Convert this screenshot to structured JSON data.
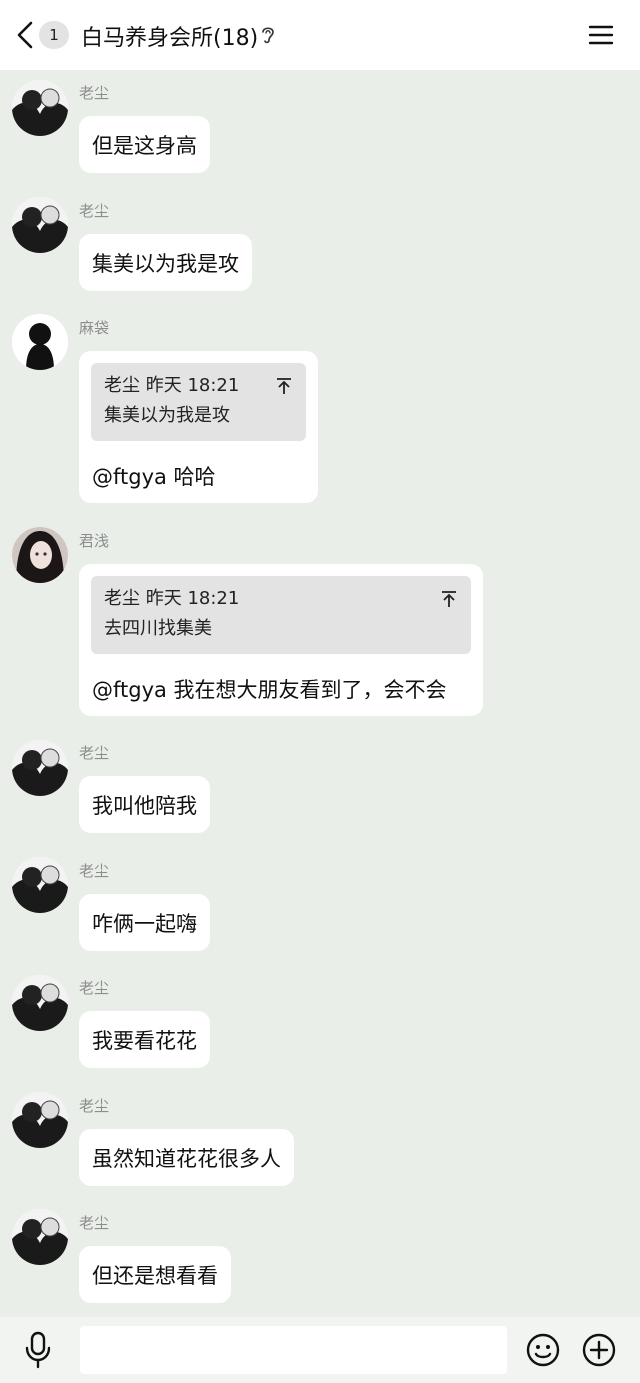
{
  "header": {
    "unread_count": "1",
    "title": "白马养身会所(18)"
  },
  "messages": [
    {
      "sender": "老尘",
      "text": "但是这身高"
    },
    {
      "sender": "老尘",
      "text": "集美以为我是攻"
    },
    {
      "sender": "麻袋",
      "quote": {
        "meta": "老尘 昨天 18:21",
        "text": "集美以为我是攻"
      },
      "text": "@ftgya 哈哈"
    },
    {
      "sender": "君浅",
      "quote": {
        "meta": "老尘 昨天 18:21",
        "text": "去四川找集美"
      },
      "text": "@ftgya 我在想大朋友看到了，会不会"
    },
    {
      "sender": "老尘",
      "text": "我叫他陪我"
    },
    {
      "sender": "老尘",
      "text": "咋俩一起嗨"
    },
    {
      "sender": "老尘",
      "text": "我要看花花"
    },
    {
      "sender": "老尘",
      "text": "虽然知道花花很多人"
    },
    {
      "sender": "老尘",
      "text": "但还是想看看"
    }
  ],
  "input": {
    "placeholder": ""
  }
}
